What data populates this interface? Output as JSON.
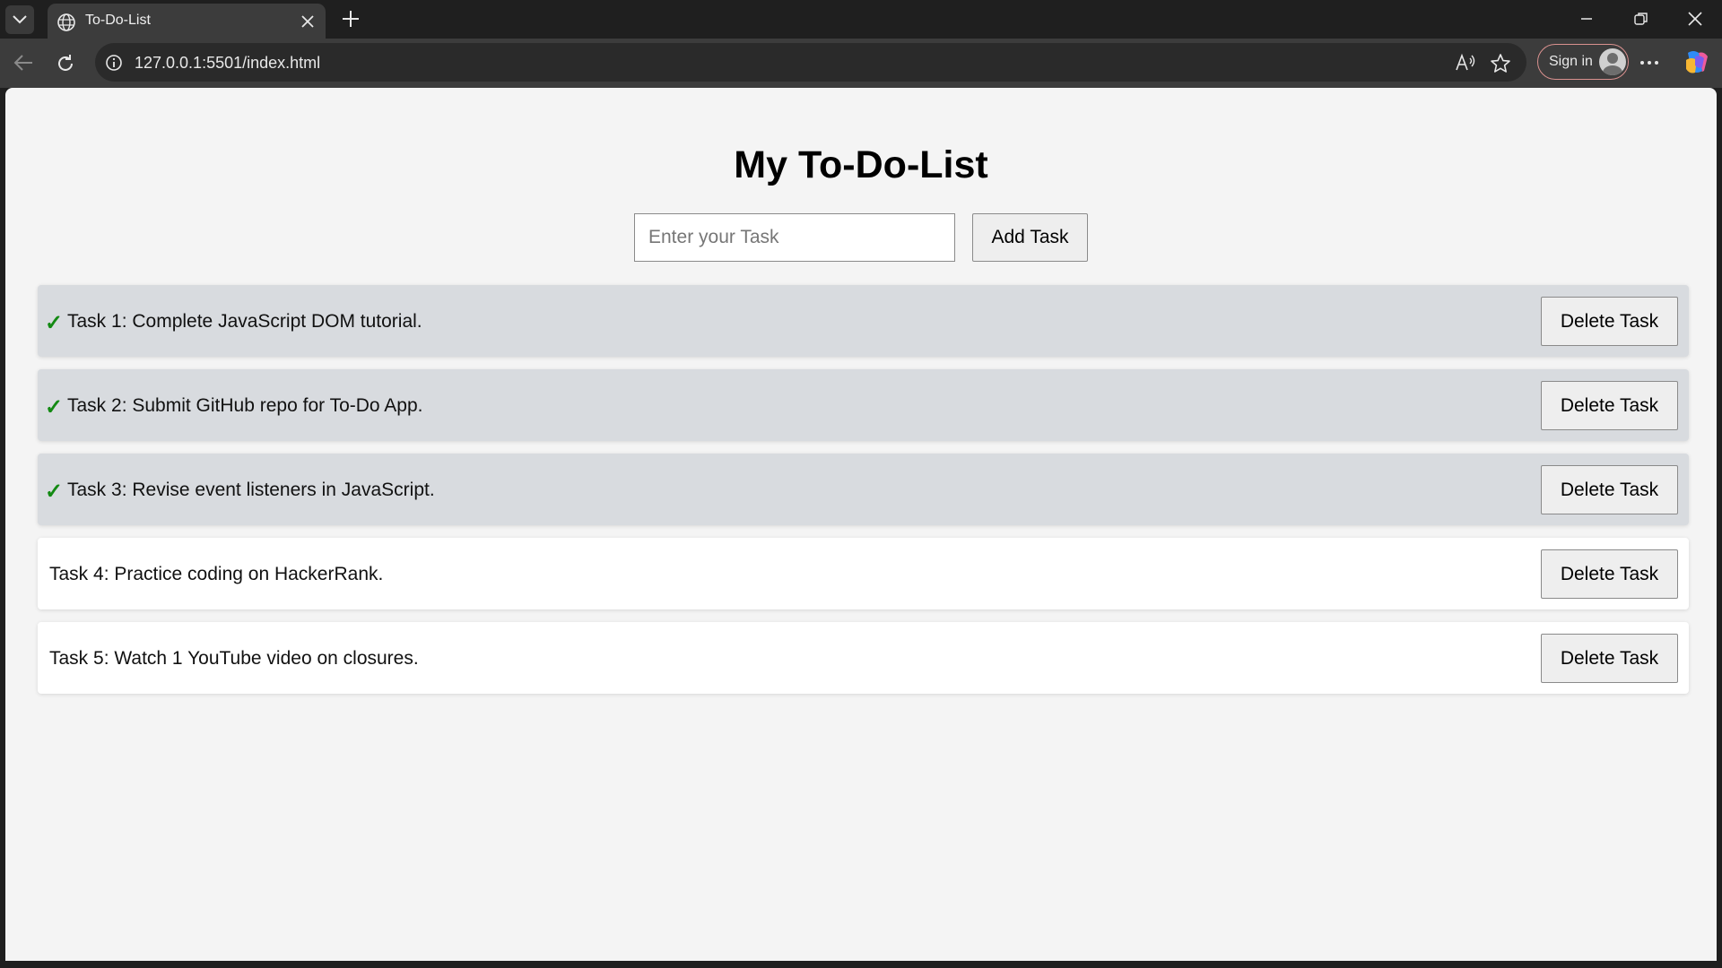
{
  "browser": {
    "tab_title": "To-Do-List",
    "url": "127.0.0.1:5501/index.html",
    "signin_label": "Sign in"
  },
  "page": {
    "title": "My To-Do-List",
    "input_placeholder": "Enter your Task",
    "input_value": "",
    "add_button_label": "Add Task",
    "check_mark": "✓",
    "tasks": [
      {
        "text": "Task 1: Complete JavaScript DOM tutorial.",
        "completed": true,
        "delete_label": "Delete Task"
      },
      {
        "text": "Task 2: Submit GitHub repo for To-Do App.",
        "completed": true,
        "delete_label": "Delete Task"
      },
      {
        "text": "Task 3: Revise event listeners in JavaScript.",
        "completed": true,
        "delete_label": "Delete Task"
      },
      {
        "text": "Task 4: Practice coding on HackerRank.",
        "completed": false,
        "delete_label": "Delete Task"
      },
      {
        "text": "Task 5: Watch 1 YouTube video on closures.",
        "completed": false,
        "delete_label": "Delete Task"
      }
    ]
  },
  "colors": {
    "completed_bg": "#d8dbdf",
    "pending_bg": "#ffffff",
    "check": "#138a13",
    "page_bg": "#f4f4f4"
  }
}
